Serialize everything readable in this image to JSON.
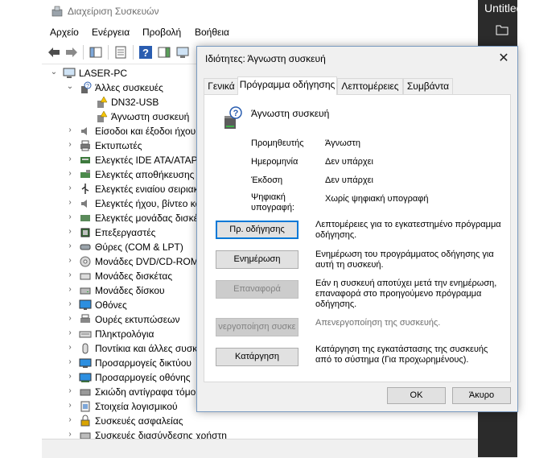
{
  "device_manager": {
    "title": "Διαχείριση Συσκευών",
    "menu": [
      "Αρχείο",
      "Ενέργεια",
      "Προβολή",
      "Βοήθεια"
    ],
    "tree": [
      {
        "label": "LASER-PC",
        "level": 0,
        "expander": "expanded",
        "icon": "computer-icon"
      },
      {
        "label": "Άλλες συσκευές",
        "level": 1,
        "expander": "expanded",
        "icon": "unknown-device-icon"
      },
      {
        "label": "DN32-USB",
        "level": 2,
        "expander": "none",
        "icon": "unknown-device-warning-icon"
      },
      {
        "label": "Άγνωστη συσκευή",
        "level": 2,
        "expander": "none",
        "icon": "unknown-device-warning-icon"
      },
      {
        "label": "Είσοδοι και έξοδοι ήχου",
        "level": 1,
        "expander": "collapsed",
        "icon": "speaker-icon"
      },
      {
        "label": "Εκτυπωτές",
        "level": 1,
        "expander": "collapsed",
        "icon": "printer-icon"
      },
      {
        "label": "Ελεγκτές IDE ATA/ATAPI",
        "level": 1,
        "expander": "collapsed",
        "icon": "ide-controller-icon"
      },
      {
        "label": "Ελεγκτές αποθήκευσης",
        "level": 1,
        "expander": "collapsed",
        "icon": "storage-controller-icon"
      },
      {
        "label": "Ελεγκτές ενιαίου σειριακού διαύλου",
        "level": 1,
        "expander": "collapsed",
        "icon": "usb-icon"
      },
      {
        "label": "Ελεγκτές ήχου, βίντεο και παιχνιδιών",
        "level": 1,
        "expander": "collapsed",
        "icon": "speaker-icon"
      },
      {
        "label": "Ελεγκτές μονάδας δισκέτας",
        "level": 1,
        "expander": "collapsed",
        "icon": "floppy-controller-icon"
      },
      {
        "label": "Επεξεργαστές",
        "level": 1,
        "expander": "collapsed",
        "icon": "processor-icon"
      },
      {
        "label": "Θύρες (COM & LPT)",
        "level": 1,
        "expander": "collapsed",
        "icon": "port-icon"
      },
      {
        "label": "Μονάδες DVD/CD-ROM",
        "level": 1,
        "expander": "collapsed",
        "icon": "dvd-drive-icon"
      },
      {
        "label": "Μονάδες δισκέτας",
        "level": 1,
        "expander": "collapsed",
        "icon": "floppy-drive-icon"
      },
      {
        "label": "Μονάδες δίσκου",
        "level": 1,
        "expander": "collapsed",
        "icon": "disk-drive-icon"
      },
      {
        "label": "Οθόνες",
        "level": 1,
        "expander": "collapsed",
        "icon": "monitor-icon"
      },
      {
        "label": "Ουρές εκτυπώσεων",
        "level": 1,
        "expander": "collapsed",
        "icon": "print-queue-icon"
      },
      {
        "label": "Πληκτρολόγια",
        "level": 1,
        "expander": "collapsed",
        "icon": "keyboard-icon"
      },
      {
        "label": "Ποντίκια και άλλες συσκευές κατάδειξης",
        "level": 1,
        "expander": "collapsed",
        "icon": "mouse-icon"
      },
      {
        "label": "Προσαρμογείς δικτύου",
        "level": 1,
        "expander": "collapsed",
        "icon": "network-adapter-icon"
      },
      {
        "label": "Προσαρμογείς οθόνης",
        "level": 1,
        "expander": "collapsed",
        "icon": "display-adapter-icon"
      },
      {
        "label": "Σκιώδη αντίγραφα τόμου",
        "level": 1,
        "expander": "collapsed",
        "icon": "volume-icon"
      },
      {
        "label": "Στοιχεία λογισμικού",
        "level": 1,
        "expander": "collapsed",
        "icon": "software-component-icon"
      },
      {
        "label": "Συσκευές ασφαλείας",
        "level": 1,
        "expander": "collapsed",
        "icon": "security-device-icon"
      },
      {
        "label": "Συσκευές διασύνδεσης χρήστη",
        "level": 1,
        "expander": "collapsed",
        "icon": "hid-icon"
      }
    ]
  },
  "side_panel": {
    "title": "Untitled"
  },
  "dialog": {
    "title": "Ιδιότητες: Άγνωστη συσκευή",
    "tabs": [
      "Γενικά",
      "Πρόγραμμα οδήγησης",
      "Λεπτομέρειες",
      "Συμβάντα"
    ],
    "active_tab": 1,
    "device_name": "Άγνωστη συσκευή",
    "properties": [
      {
        "label": "Προμηθευτής",
        "value": "Άγνωστη"
      },
      {
        "label": "Ημερομηνία",
        "value": "Δεν υπάρχει"
      },
      {
        "label": "Έκδοση",
        "value": "Δεν υπάρχει"
      },
      {
        "label": "Ψηφιακή υπογραφή:",
        "value": "Χωρίς ψηφιακή υπογραφή"
      }
    ],
    "actions": [
      {
        "button": "Πρ. οδήγησης",
        "desc": "Λεπτομέρειες για το εγκατεστημένο πρόγραμμα οδήγησης.",
        "enabled": true,
        "default": true
      },
      {
        "button": "Ενημέρωση",
        "desc": "Ενημέρωση του προγράμματος οδήγησης για αυτή τη συσκευή.",
        "enabled": true,
        "default": false
      },
      {
        "button": "Επαναφορά",
        "desc": "Εάν η συσκευή αποτύχει μετά την ενημέρωση, επαναφορά στο προηγούμενο πρόγραμμα οδήγησης.",
        "enabled": false,
        "default": false
      },
      {
        "button": "νεργοποίηση συσκε",
        "desc": "Απενεργοποίηση της συσκευής.",
        "enabled": false,
        "default": false
      },
      {
        "button": "Κατάργηση",
        "desc": "Κατάργηση της εγκατάστασης της συσκευής από το σύστημα (Για προχωρημένους).",
        "enabled": true,
        "default": false
      }
    ],
    "ok_label": "OK",
    "cancel_label": "Άκυρο"
  },
  "colors": {
    "accent": "#0078d7",
    "side_panel_bg": "#2b2b2b",
    "dialog_bg": "#f0f0f0"
  }
}
